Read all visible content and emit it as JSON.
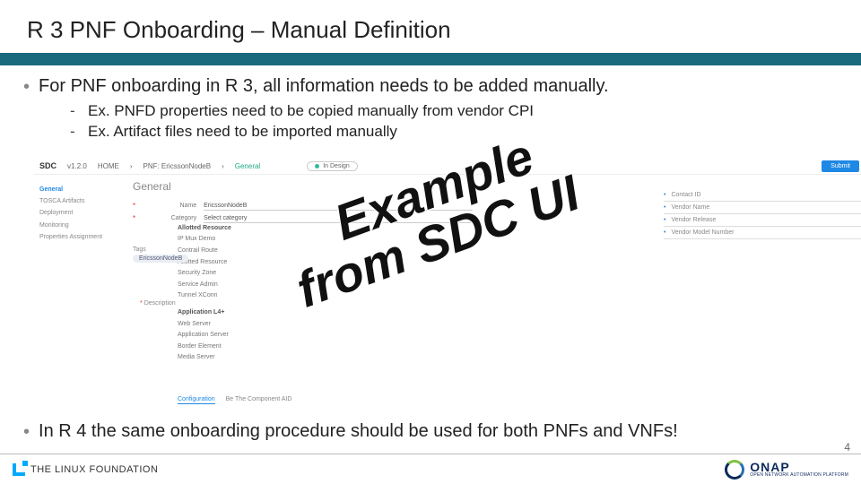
{
  "title": "R 3 PNF Onboarding – Manual Definition",
  "bullets": {
    "b1": "For PNF onboarding in R 3, all information needs to be added manually.",
    "sub1": "Ex. PNFD properties need to be copied manually from vendor CPI",
    "sub2": "Ex. Artifact files need to be imported manually",
    "b2": "In R 4 the same onboarding procedure should be used for both PNFs and VNFs!"
  },
  "overlay": "  Example\nfrom SDC UI",
  "ui": {
    "brand": "SDC",
    "version": "v1.2.0",
    "crumbs": {
      "home": "HOME",
      "path": "PNF: EricssonNodeB",
      "tab": "General"
    },
    "pill": "In Design",
    "primary_btn": "Submit",
    "sidebar": {
      "general": "General",
      "i2": "TOSCA Artifacts",
      "i3": "Deployment",
      "i4": "Monitoring",
      "i5": "Properties Assignment"
    },
    "main_heading": "General",
    "form": {
      "name_label": "Name",
      "name_value": "EricssonNodeB",
      "cat_label": "Category",
      "cat_value": "Select category"
    },
    "mid": {
      "s1": "Allotted Resource",
      "i1": "IP Mux Demo",
      "i2": "Contrail Route",
      "i3": "Allotted Resource",
      "i4": "Security Zone",
      "i5": "Service Admin",
      "i6": "Tunnel XConn",
      "s2": "Application L4+",
      "i7": "Web Server",
      "i8": "Application Server",
      "i9": "Border Element",
      "i10": "Media Server"
    },
    "tags_label": "Tags",
    "tag_chip": "EricssonNodeB",
    "desc_label": "Description",
    "right": {
      "r1": "Contact ID",
      "r2": "Vendor Name",
      "r3": "Vendor Release",
      "r4": "Vendor Model Number"
    },
    "tabs": {
      "t1": "Configuration",
      "t2": "Be The Component AID"
    }
  },
  "footer": {
    "linux": "THE LINUX FOUNDATION",
    "onap": "ONAP",
    "onap_sub": "OPEN NETWORK AUTOMATION PLATFORM"
  },
  "page_number": "4"
}
